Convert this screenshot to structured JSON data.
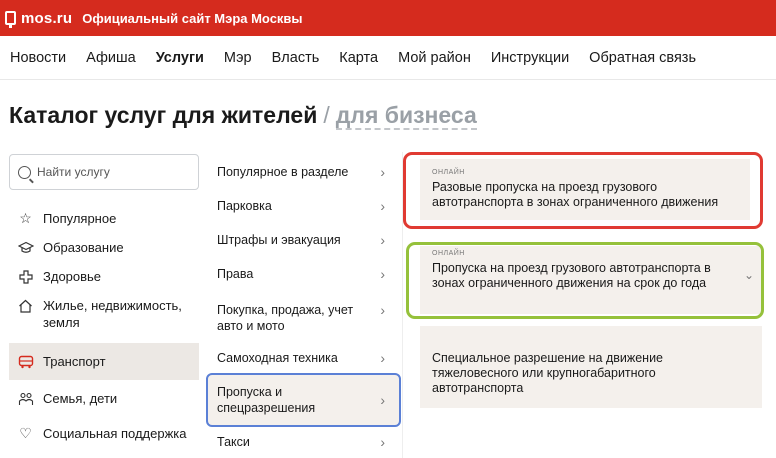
{
  "topbar": {
    "logo": "mos.ru",
    "title": "Официальный сайт Мэра Москвы"
  },
  "nav": [
    {
      "label": "Новости"
    },
    {
      "label": "Афиша"
    },
    {
      "label": "Услуги",
      "active": true
    },
    {
      "label": "Мэр"
    },
    {
      "label": "Власть"
    },
    {
      "label": "Карта"
    },
    {
      "label": "Мой район"
    },
    {
      "label": "Инструкции"
    },
    {
      "label": "Обратная связь"
    }
  ],
  "page": {
    "title": "Каталог услуг для жителей",
    "separator": "/",
    "alt_link": "для бизнеса"
  },
  "search": {
    "placeholder": "Найти услугу"
  },
  "categories": [
    {
      "label": "Популярное",
      "icon": "star-icon"
    },
    {
      "label": "Образование",
      "icon": "graduation-cap-icon"
    },
    {
      "label": "Здоровье",
      "icon": "medical-cross-icon"
    },
    {
      "label": "Жилье, недвижимость, земля",
      "icon": "house-icon"
    },
    {
      "label": "Транспорт",
      "icon": "bus-icon",
      "active": true
    },
    {
      "label": "Семья, дети",
      "icon": "family-icon"
    },
    {
      "label": "Социальная поддержка",
      "icon": "heart-icon"
    }
  ],
  "subcategories": [
    {
      "label": "Популярное в разделе"
    },
    {
      "label": "Парковка"
    },
    {
      "label": "Штрафы и эвакуация"
    },
    {
      "label": "Права"
    },
    {
      "label": "Покупка, продажа, учет авто и мото"
    },
    {
      "label": "Самоходная техника"
    },
    {
      "label": "Пропуска и спецразрешения",
      "active": true
    },
    {
      "label": "Такси"
    }
  ],
  "services": [
    {
      "badge": "онлайн",
      "title": "Разовые пропуска на проезд грузового автотранспорта в зонах ограниченного движения"
    },
    {
      "badge": "онлайн",
      "title": "Пропуска на проезд грузового автотранспорта в зонах ограниченного движения на срок до года"
    },
    {
      "badge": "",
      "title": "Специальное разрешение на движение тяжеловесного или крупногабаритного автотранспорта"
    }
  ],
  "colors": {
    "brand": "#d52b1e",
    "highlight_red": "#e03a32",
    "highlight_green": "#95c13b",
    "highlight_blue": "#5b80d6",
    "card_bg": "#f4f0ec"
  }
}
